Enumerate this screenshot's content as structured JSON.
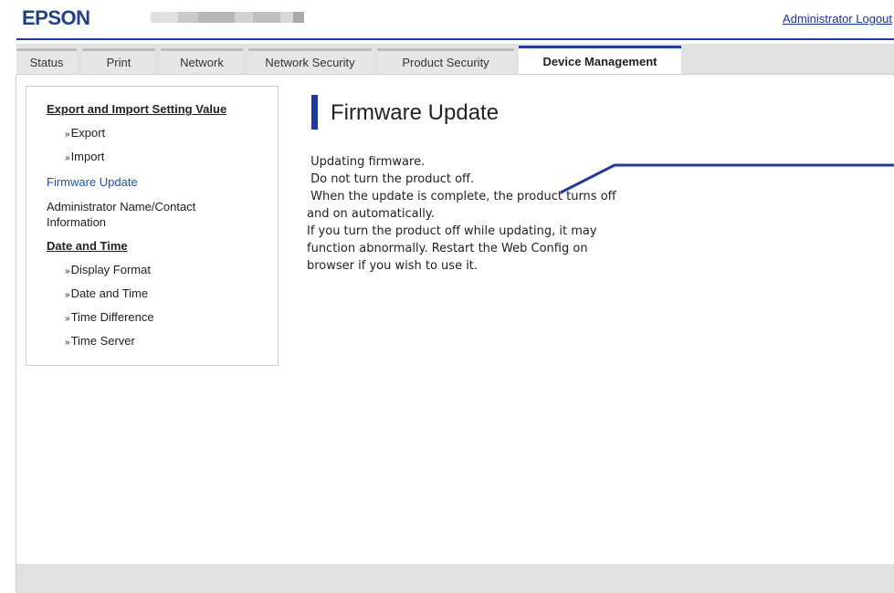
{
  "header": {
    "logo_text": "EPSON",
    "logout_label": "Administrator Logout"
  },
  "tabs": [
    {
      "label": "Status"
    },
    {
      "label": "Print"
    },
    {
      "label": "Network"
    },
    {
      "label": "Network Security"
    },
    {
      "label": "Product Security"
    },
    {
      "label": "Device Management",
      "active": true
    }
  ],
  "sidebar": {
    "items": [
      {
        "label": "Export and Import Setting Value"
      },
      {
        "label": "Export"
      },
      {
        "label": "Import"
      },
      {
        "label": "Firmware Update"
      },
      {
        "label": "Administrator Name/Contact Information"
      },
      {
        "label": "Date and Time"
      },
      {
        "label": "Display Format"
      },
      {
        "label": "Date and Time"
      },
      {
        "label": "Time Difference"
      },
      {
        "label": "Time Server"
      }
    ],
    "sub_marker": "»"
  },
  "main": {
    "title": "Firmware Update",
    "message_lines": [
      " Updating firmware.",
      " Do not turn the product off.",
      " When the update is complete, the product turns off",
      "and on automatically.",
      "If you turn the product off while updating, it may",
      "function abnormally. Restart the Web Config on",
      "browser if you wish to use it."
    ]
  },
  "colors": {
    "accent": "#1e3aa8",
    "link": "#1a33a6",
    "current_menu": "#1a4fd6",
    "tab_bg": "#e6e6e6",
    "footer_bg": "#e1e1e1"
  }
}
